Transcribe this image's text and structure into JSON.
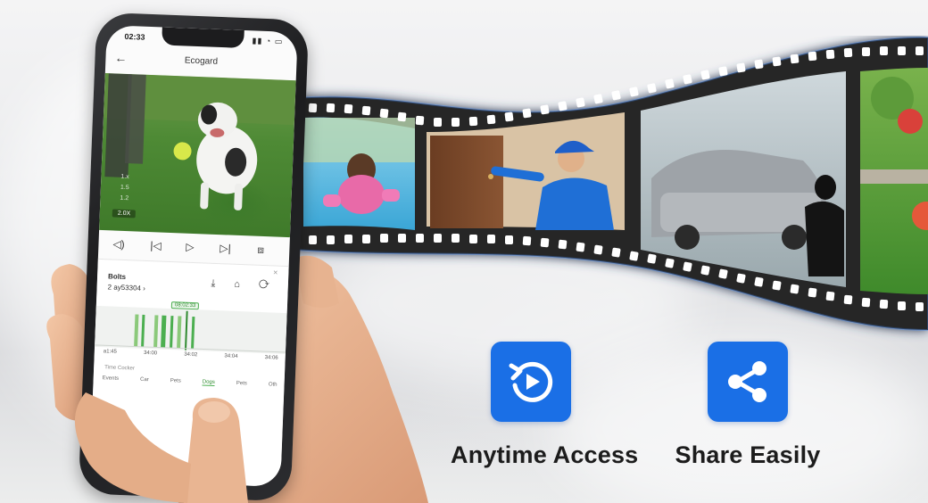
{
  "phone": {
    "status_time": "02:33",
    "status_icons": "▮▮ ◔ ▭",
    "header_title": "Ecogard",
    "speed": "2.0X",
    "overlay_a": "1.x",
    "overlay_b": "1.5",
    "overlay_c": "1.2",
    "panel_label": "Bolts",
    "panel_sub": "2 ay53304 ›",
    "panel_close": "×",
    "panel_icons": "⤓ ⌂ ⟳",
    "time_pill": "08:02:33",
    "timeline_labels": [
      "a1:45",
      "34:00",
      "34:02",
      "34:04",
      "34:06"
    ],
    "timeline_sub": "Time Cocker",
    "timeline_tabs": [
      "Events",
      "Car",
      "Pets",
      "Dogs",
      "Pets",
      "Oth"
    ]
  },
  "features": [
    {
      "label": "Anytime Access",
      "icon": "replay-play-icon"
    },
    {
      "label": "Share Easily",
      "icon": "share-icon"
    }
  ],
  "colors": {
    "feature_icon_bg": "#1a6fe6",
    "film_strip": "#2a2a2c",
    "accent_green": "#4caf50"
  }
}
